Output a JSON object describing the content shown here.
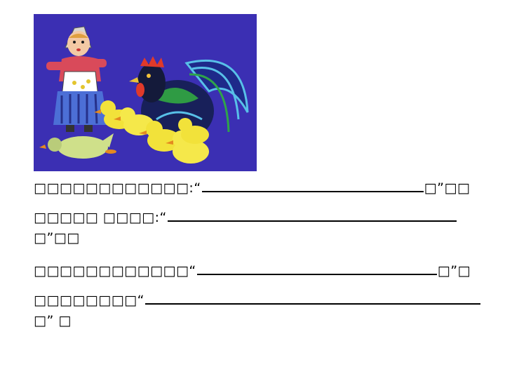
{
  "illustration": {
    "subject_icons": [
      "girl-icon",
      "rooster-icon",
      "duckling-icon",
      "duck-icon"
    ],
    "background_color": "#3b2fb3"
  },
  "exercise": {
    "line1": {
      "prefix": "□□□□□□□□□□□□:“",
      "suffix": "□”□□"
    },
    "line2": {
      "prefix": "□□□□□ □□□□:“",
      "suffix": "□”□□"
    },
    "line3": {
      "prefix": "□□□□□□□□□□□□“",
      "suffix": "□”□"
    },
    "line4": {
      "prefix": "□□□□□□□□“",
      "suffix": "□” □"
    }
  }
}
